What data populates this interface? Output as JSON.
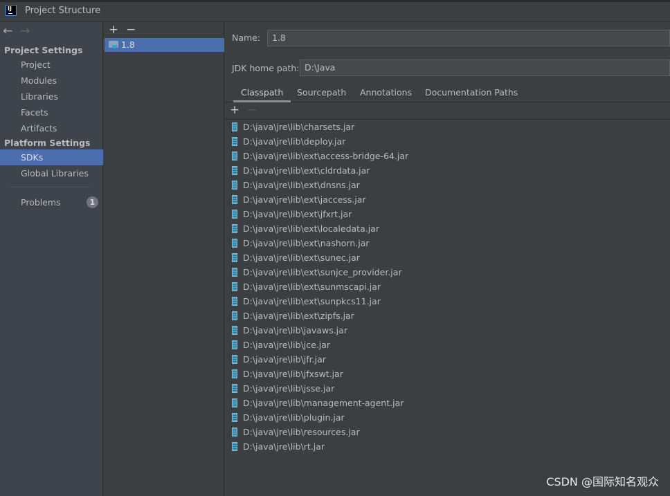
{
  "window": {
    "title": "Project Structure",
    "logo": "IJ"
  },
  "sidebar": {
    "sections": [
      {
        "label": "Project Settings",
        "items": [
          "Project",
          "Modules",
          "Libraries",
          "Facets",
          "Artifacts"
        ]
      },
      {
        "label": "Platform Settings",
        "items": [
          "SDKs",
          "Global Libraries"
        ]
      }
    ],
    "selected": "SDKs",
    "problems": {
      "label": "Problems",
      "count": "1"
    }
  },
  "sdk_list": {
    "items": [
      "1.8"
    ]
  },
  "detail": {
    "name_label": "Name:",
    "name_value": "1.8",
    "home_label": "JDK home path:",
    "home_value": "D:\\Java",
    "tabs": [
      "Classpath",
      "Sourcepath",
      "Annotations",
      "Documentation Paths"
    ],
    "active_tab": "Classpath",
    "classpath": [
      "D:\\java\\jre\\lib\\charsets.jar",
      "D:\\java\\jre\\lib\\deploy.jar",
      "D:\\java\\jre\\lib\\ext\\access-bridge-64.jar",
      "D:\\java\\jre\\lib\\ext\\cldrdata.jar",
      "D:\\java\\jre\\lib\\ext\\dnsns.jar",
      "D:\\java\\jre\\lib\\ext\\jaccess.jar",
      "D:\\java\\jre\\lib\\ext\\jfxrt.jar",
      "D:\\java\\jre\\lib\\ext\\localedata.jar",
      "D:\\java\\jre\\lib\\ext\\nashorn.jar",
      "D:\\java\\jre\\lib\\ext\\sunec.jar",
      "D:\\java\\jre\\lib\\ext\\sunjce_provider.jar",
      "D:\\java\\jre\\lib\\ext\\sunmscapi.jar",
      "D:\\java\\jre\\lib\\ext\\sunpkcs11.jar",
      "D:\\java\\jre\\lib\\ext\\zipfs.jar",
      "D:\\java\\jre\\lib\\javaws.jar",
      "D:\\java\\jre\\lib\\jce.jar",
      "D:\\java\\jre\\lib\\jfr.jar",
      "D:\\java\\jre\\lib\\jfxswt.jar",
      "D:\\java\\jre\\lib\\jsse.jar",
      "D:\\java\\jre\\lib\\management-agent.jar",
      "D:\\java\\jre\\lib\\plugin.jar",
      "D:\\java\\jre\\lib\\resources.jar",
      "D:\\java\\jre\\lib\\rt.jar"
    ]
  },
  "watermark": "CSDN @国际知名观众",
  "colors": {
    "selection": "#4b6eaf",
    "background": "#3c3f41"
  }
}
